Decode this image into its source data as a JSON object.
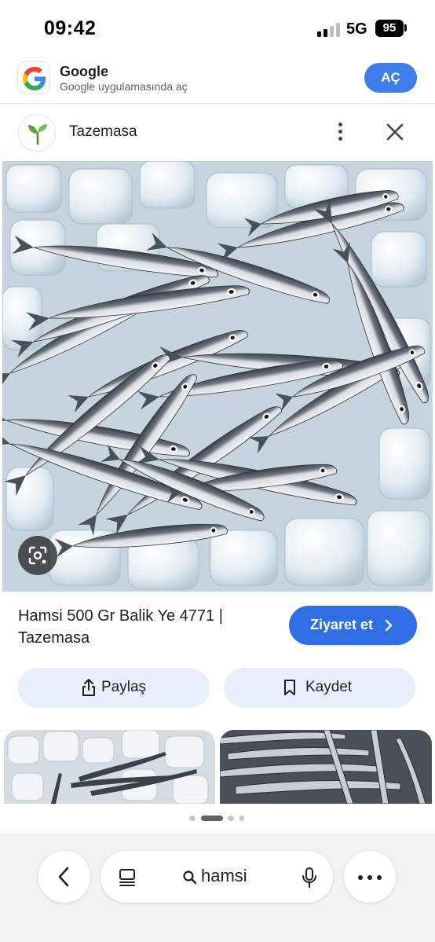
{
  "status_bar": {
    "time": "09:42",
    "network": "5G",
    "battery": "95"
  },
  "app_banner": {
    "app_name": "Google",
    "subtitle": "Google uygulamasında aç",
    "open_label": "AÇ",
    "icon": "google-g-icon"
  },
  "site": {
    "name": "Tazemasa",
    "icon": "sprout-icon"
  },
  "result": {
    "title": "Hamsi 500 Gr Balik Ye 4771 | Tazemasa",
    "visit_label": "Ziyaret et",
    "share_label": "Paylaş",
    "save_label": "Kaydet"
  },
  "bottom_bar": {
    "search_query": "hamsi"
  },
  "colors": {
    "accent_blue": "#2f6ee4",
    "banner_blue": "#3f7ee8",
    "action_bg": "#e8eefc",
    "bottom_bg": "#f2f2f2"
  }
}
